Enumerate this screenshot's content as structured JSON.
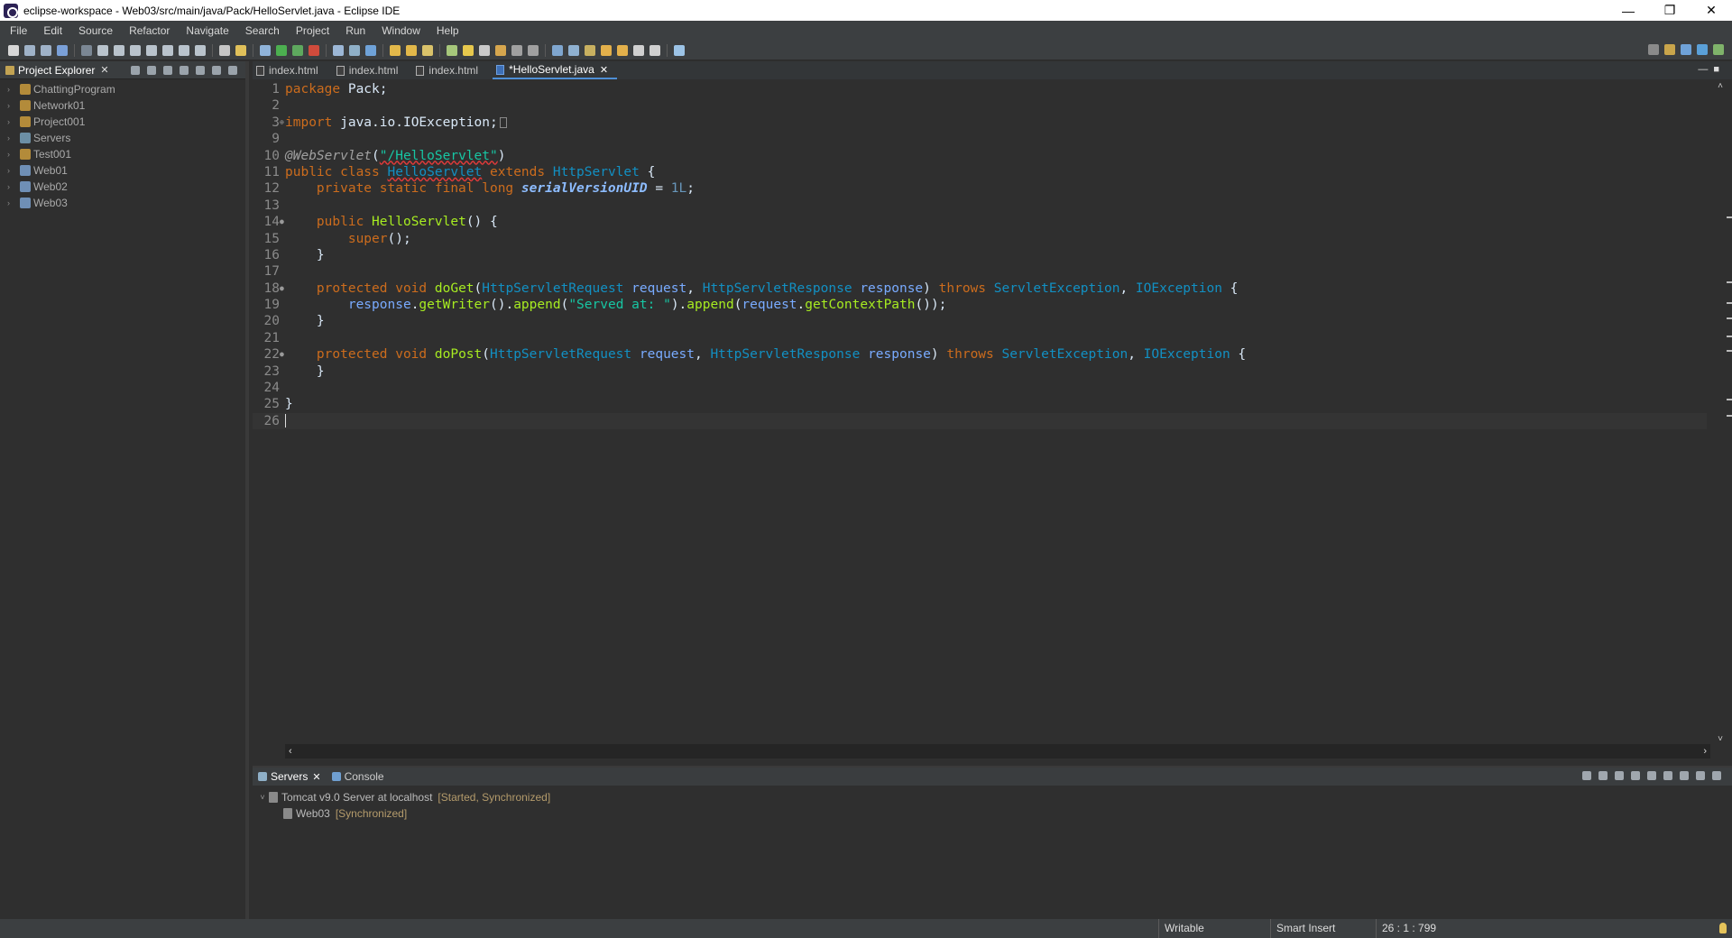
{
  "window": {
    "title": "eclipse-workspace - Web03/src/main/java/Pack/HelloServlet.java - Eclipse IDE",
    "controls": {
      "minimize": "—",
      "restore": "❐",
      "close": "✕"
    }
  },
  "menu": [
    "File",
    "Edit",
    "Source",
    "Refactor",
    "Navigate",
    "Search",
    "Project",
    "Run",
    "Window",
    "Help"
  ],
  "explorer": {
    "tab_label": "Project Explorer",
    "close_glyph": "✕",
    "projects": [
      "ChattingProgram",
      "Network01",
      "Project001",
      "Servers",
      "Test001",
      "Web01",
      "Web02",
      "Web03"
    ]
  },
  "editor": {
    "tabs": [
      {
        "label": "index.html"
      },
      {
        "label": "index.html"
      },
      {
        "label": "index.html"
      },
      {
        "label": "*HelloServlet.java",
        "active": true
      }
    ],
    "close_glyph": "✕",
    "line_numbers": [
      "1",
      "2",
      "3",
      "9",
      "10",
      "11",
      "12",
      "13",
      "14",
      "15",
      "16",
      "17",
      "18",
      "19",
      "20",
      "21",
      "22",
      "23",
      "24",
      "25",
      "26"
    ],
    "lines": {
      "l1_kw": "package",
      "l1_rest": " Pack;",
      "l3_kw": "import",
      "l3_rest": " java.io.IOException;",
      "l10_ann": "@WebServlet",
      "l10_open": "(",
      "l10_str": "\"/HelloServlet\"",
      "l10_close": ")",
      "l11_kw": "public class",
      "l11_cls": "HelloServlet",
      "l11_ext": "extends",
      "l11_super": "HttpServlet",
      "l11_end": " {",
      "l12_kw": "private static final long",
      "l12_field": "serialVersionUID",
      "l12_eq": " = ",
      "l12_num": "1L",
      "l12_end": ";",
      "l14_kw": "public",
      "l14_fn": "HelloServlet",
      "l14_end": "() {",
      "l15_fn": "super",
      "l15_end": "();",
      "l16": "}",
      "l18_kw": "protected void",
      "l18_fn": "doGet",
      "l18_t1": "HttpServletRequest",
      "l18_p1": "request",
      "l18_t2": "HttpServletResponse",
      "l18_p2": "response",
      "l18_throws": "throws",
      "l18_e1": "ServletException",
      "l18_e2": "IOException",
      "l19_p": "response",
      "l19_fn1": "getWriter",
      "l19_fn2": "append",
      "l19_str": "\"Served at: \"",
      "l19_fn3": "append",
      "l19_p2": "request",
      "l19_fn4": "getContextPath",
      "l20": "}",
      "l22_kw": "protected void",
      "l22_fn": "doPost",
      "l22_t1": "HttpServletRequest",
      "l22_p1": "request",
      "l22_t2": "HttpServletResponse",
      "l22_p2": "response",
      "l22_throws": "throws",
      "l22_e1": "ServletException",
      "l22_e2": "IOException",
      "l23": "}",
      "l25": "}"
    }
  },
  "bottom": {
    "tabs": [
      {
        "label": "Servers",
        "active": true
      },
      {
        "label": "Console"
      }
    ],
    "close_glyph": "✕",
    "server": {
      "name": "Tomcat v9.0 Server at localhost",
      "state": "[Started, Synchronized]"
    },
    "module": {
      "name": "Web03",
      "state": "[Synchronized]"
    }
  },
  "status": {
    "writable": "Writable",
    "insert_mode": "Smart Insert",
    "position": "26 : 1 : 799"
  },
  "colors": {
    "keyword": "#cc6c1d",
    "type": "#1290c3",
    "method": "#a7ec21",
    "string": "#17c6a3",
    "accent": "#4e8fd6"
  }
}
